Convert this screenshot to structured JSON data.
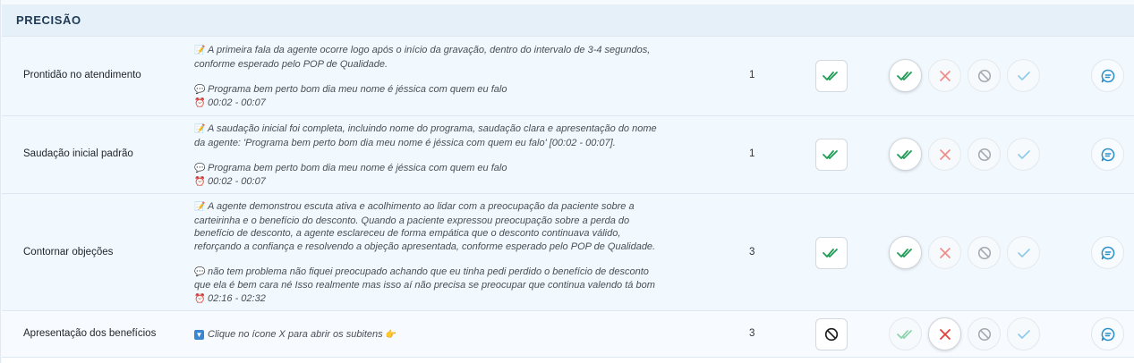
{
  "section": {
    "title": "PRECISÃO"
  },
  "rows": [
    {
      "criterion": "Prontidão no atendimento",
      "desc_line1": "A primeira fala da agente ocorre logo após o início da gravação, dentro do intervalo de 3-4 segundos,",
      "desc_line2": "conforme esperado pelo POP de Qualidade.",
      "quote": "Programa bem perto bom dia meu nome é jéssica com quem eu falo",
      "time": "00:02 - 00:07",
      "score": "1",
      "selected": "double-check"
    },
    {
      "criterion": "Saudação inicial padrão",
      "desc_line1": "A saudação inicial foi completa, incluindo nome do programa, saudação clara e apresentação do nome",
      "desc_line2": "da agente: 'Programa bem perto bom dia meu nome é jéssica com quem eu falo' [00:02 - 00:07].",
      "quote": "Programa bem perto bom dia meu nome é jéssica com quem eu falo",
      "time": "00:02 - 00:07",
      "score": "1",
      "selected": "double-check"
    },
    {
      "criterion": "Contornar objeções",
      "desc_line1": "A agente demonstrou escuta ativa e acolhimento ao lidar com a preocupação da paciente sobre a",
      "desc_line2": "carteirinha e o benefício do desconto. Quando a paciente expressou preocupação sobre a perda do",
      "desc_line3": "benefício de desconto, a agente esclareceu de forma empática que o desconto continuava válido,",
      "desc_line4": "reforçando a confiança e resolvendo a objeção apresentada, conforme esperado pelo POP de Qualidade.",
      "quote_line1": "não tem problema não fiquei preocupado achando que eu tinha pedi perdido o benefício de desconto",
      "quote_line2": "que ela é bem cara né Isso realmente mas isso aí não precisa se preocupar que continua valendo tá bom",
      "time": "02:16 - 02:32",
      "score": "3",
      "selected": "double-check"
    },
    {
      "criterion": "Apresentação dos benefícios",
      "desc_line1": "Clique no ícone X para abrir os subitens",
      "score": "3",
      "selected": "not-applicable"
    }
  ],
  "icons": {
    "note": "memo-icon",
    "speech": "speech-bubble-icon",
    "clock": "alarm-clock-icon",
    "info": "down-arrow-box-icon",
    "pointer": "pointing-hand-icon",
    "double_check": "double-check-icon",
    "cross": "cross-icon",
    "not_applicable": "not-applicable-icon",
    "check": "check-icon",
    "comment": "comment-icon"
  },
  "colors": {
    "header_bg": "#e6f0f9",
    "row_bg": "#f1f8fe",
    "green": "#1f9d55",
    "red": "#e0403a",
    "gray": "#9aa0a6",
    "blue": "#2a8fc9"
  }
}
